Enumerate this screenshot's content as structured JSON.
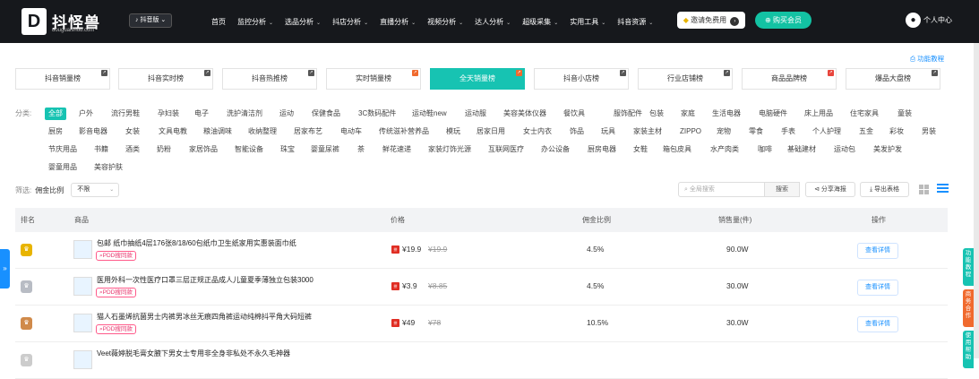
{
  "header": {
    "logo_mark": "D",
    "logo_cn": "抖怪兽",
    "logo_en": "douguaishou.com",
    "version": "抖音版",
    "nav": [
      {
        "label": "首页",
        "dropdown": false
      },
      {
        "label": "监控分析",
        "dropdown": true
      },
      {
        "label": "选品分析",
        "dropdown": true
      },
      {
        "label": "抖店分析",
        "dropdown": true
      },
      {
        "label": "直播分析",
        "dropdown": true
      },
      {
        "label": "视频分析",
        "dropdown": true
      },
      {
        "label": "达人分析",
        "dropdown": true
      },
      {
        "label": "超级采集",
        "dropdown": true
      },
      {
        "label": "实用工具",
        "dropdown": true
      },
      {
        "label": "抖音资源",
        "dropdown": true
      }
    ],
    "invite_label": "邀请免费用",
    "buy_label": "购买会员",
    "user_label": "个人中心"
  },
  "help_label": "功能教程",
  "tabs": [
    {
      "label": "抖音销量榜",
      "badge": "dark"
    },
    {
      "label": "抖音实时榜",
      "badge": "dark"
    },
    {
      "label": "抖音热推榜",
      "badge": "dark"
    },
    {
      "label": "实时销量榜",
      "badge": "org"
    },
    {
      "label": "全天销量榜",
      "badge": "org",
      "active": true
    },
    {
      "label": "抖音小店榜",
      "badge": "dark"
    },
    {
      "label": "行业店铺榜",
      "badge": "dark"
    },
    {
      "label": "商品品牌榜",
      "badge": "red"
    },
    {
      "label": "爆品大盘榜",
      "badge": "dark"
    }
  ],
  "categories": {
    "label": "分类:",
    "rows": [
      [
        "全部",
        "户外",
        "流行男鞋",
        "孕妇装",
        "电子",
        "洗护清洁剂",
        "运动",
        "保健食品",
        "3C数码配件",
        "运动鞋new",
        "运动服",
        "美容美体仪器",
        "餐饮具",
        "服饰配件",
        "包装",
        "家庭",
        "生活电器",
        "电脑硬件",
        "床上用品",
        "住宅家具",
        "童装"
      ],
      [
        "厨房",
        "影音电器",
        "女装",
        "文具电教",
        "粮油调味",
        "收纳整理",
        "居家布艺",
        "电动车",
        "传统滋补营养品",
        "模玩",
        "居家日用",
        "女士内衣",
        "饰品",
        "玩具",
        "家装主材",
        "ZIPPO",
        "宠物",
        "零食",
        "手表",
        "个人护理",
        "五金",
        "彩妆",
        "男装"
      ],
      [
        "节庆用品",
        "书籍",
        "酒类",
        "奶粉",
        "家居饰品",
        "智能设备",
        "珠宝",
        "婴童尿裤",
        "茶",
        "鲜花速递",
        "家装灯饰光源",
        "互联网医疗",
        "办公设备",
        "厨房电器",
        "女鞋",
        "箱包皮具",
        "水产肉类",
        "咖啡",
        "基础建材",
        "运动包",
        "美发护发"
      ],
      [
        "婴童用品",
        "美容护肤"
      ]
    ]
  },
  "filter": {
    "label": "筛选:",
    "field": "佣金比例",
    "value": "不限"
  },
  "search_placeholder": "全局搜索",
  "search_button": "搜索",
  "share_button": "分享海报",
  "export_button": "导出表格",
  "table": {
    "headers": [
      "排名",
      "商品",
      "价格",
      "佣金比例",
      "销售量(件)",
      "操作"
    ],
    "rows": [
      {
        "title": "包邮 纸巾抽纸4层176张8/18/60包纸巾卫生纸家用实惠装面巾纸",
        "tag": "PDD搜同款",
        "price": "¥19.9",
        "orig": "¥19.9",
        "commission": "4.5%",
        "sales": "90.0W",
        "action": "查看详情",
        "rank_color": "#e8b400"
      },
      {
        "title": "医用外科一次性医疗口罩三层正规正品成人儿童夏季薄独立包装3000",
        "tag": "PDD搜同款",
        "price": "¥3.9",
        "orig": "¥8.85",
        "commission": "4.5%",
        "sales": "30.0W",
        "action": "查看详情",
        "rank_color": "#b8bcc4"
      },
      {
        "title": "猫人石墨烯抗菌男士内裤男冰丝无痕四角裤运动纯棉抖平角大码短裤",
        "tag": "PDD搜同款",
        "price": "¥49",
        "orig": "¥78",
        "commission": "10.5%",
        "sales": "30.0W",
        "action": "查看详情",
        "rank_color": "#d08a4a"
      },
      {
        "title": "Veet薇婷脱毛膏女腋下男女士专用非全身非私处不永久毛神器",
        "tag": "",
        "price": "",
        "orig": "",
        "commission": "",
        "sales": "",
        "action": "",
        "rank_color": "#cccccc"
      }
    ]
  },
  "side": {
    "left": "»",
    "right": [
      "功能教程",
      "商务合作",
      "使用帮助"
    ]
  }
}
